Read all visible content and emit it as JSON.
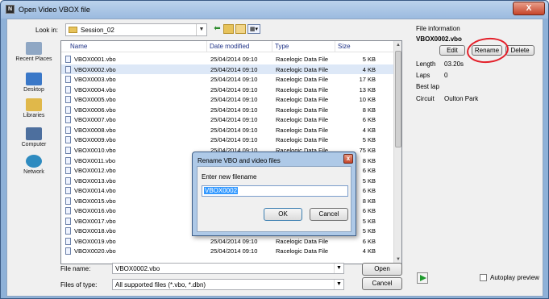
{
  "window": {
    "title": "Open Video VBOX file",
    "app_icon_text": "N",
    "close_glyph": "X"
  },
  "toolbar": {
    "look_in_label": "Look in:",
    "look_in_value": "Session_02"
  },
  "places": [
    {
      "label": "Recent Places",
      "color": "#8fa7c4"
    },
    {
      "label": "Desktop",
      "color": "#3a78c8"
    },
    {
      "label": "Libraries",
      "color": "#e0b84a"
    },
    {
      "label": "Computer",
      "color": "#4d6f9e"
    },
    {
      "label": "Network",
      "color": "#2e8bc0"
    }
  ],
  "file_list": {
    "columns": [
      "Name",
      "Date modified",
      "Type",
      "Size"
    ],
    "rows": [
      {
        "name": "VBOX0001.vbo",
        "date": "25/04/2014 09:10",
        "type": "Racelogic Data File",
        "size": "5 KB",
        "selected": false
      },
      {
        "name": "VBOX0002.vbo",
        "date": "25/04/2014 09:10",
        "type": "Racelogic Data File",
        "size": "4 KB",
        "selected": true
      },
      {
        "name": "VBOX0003.vbo",
        "date": "25/04/2014 09:10",
        "type": "Racelogic Data File",
        "size": "17 KB",
        "selected": false
      },
      {
        "name": "VBOX0004.vbo",
        "date": "25/04/2014 09:10",
        "type": "Racelogic Data File",
        "size": "13 KB",
        "selected": false
      },
      {
        "name": "VBOX0005.vbo",
        "date": "25/04/2014 09:10",
        "type": "Racelogic Data File",
        "size": "10 KB",
        "selected": false
      },
      {
        "name": "VBOX0006.vbo",
        "date": "25/04/2014 09:10",
        "type": "Racelogic Data File",
        "size": "8 KB",
        "selected": false
      },
      {
        "name": "VBOX0007.vbo",
        "date": "25/04/2014 09:10",
        "type": "Racelogic Data File",
        "size": "6 KB",
        "selected": false
      },
      {
        "name": "VBOX0008.vbo",
        "date": "25/04/2014 09:10",
        "type": "Racelogic Data File",
        "size": "4 KB",
        "selected": false
      },
      {
        "name": "VBOX0009.vbo",
        "date": "25/04/2014 09:10",
        "type": "Racelogic Data File",
        "size": "5 KB",
        "selected": false
      },
      {
        "name": "VBOX0010.vbo",
        "date": "25/04/2014 09:10",
        "type": "Racelogic Data File",
        "size": "75 KB",
        "selected": false
      },
      {
        "name": "VBOX0011.vbo",
        "date": "",
        "type": "",
        "size": "8 KB",
        "selected": false
      },
      {
        "name": "VBOX0012.vbo",
        "date": "",
        "type": "",
        "size": "6 KB",
        "selected": false
      },
      {
        "name": "VBOX0013.vbo",
        "date": "",
        "type": "",
        "size": "5 KB",
        "selected": false
      },
      {
        "name": "VBOX0014.vbo",
        "date": "",
        "type": "",
        "size": "6 KB",
        "selected": false
      },
      {
        "name": "VBOX0015.vbo",
        "date": "",
        "type": "",
        "size": "8 KB",
        "selected": false
      },
      {
        "name": "VBOX0016.vbo",
        "date": "",
        "type": "",
        "size": "6 KB",
        "selected": false
      },
      {
        "name": "VBOX0017.vbo",
        "date": "",
        "type": "",
        "size": "5 KB",
        "selected": false
      },
      {
        "name": "VBOX0018.vbo",
        "date": "",
        "type": "",
        "size": "5 KB",
        "selected": false
      },
      {
        "name": "VBOX0019.vbo",
        "date": "25/04/2014 09:10",
        "type": "Racelogic Data File",
        "size": "6 KB",
        "selected": false
      },
      {
        "name": "VBOX0020.vbo",
        "date": "25/04/2014 09:10",
        "type": "Racelogic Data File",
        "size": "4 KB",
        "selected": false
      }
    ]
  },
  "footer": {
    "filename_label": "File name:",
    "filename_value": "VBOX0002.vbo",
    "filetype_label": "Files of type:",
    "filetype_value": "All supported files (*.vbo, *.dbn)",
    "open_label": "Open",
    "cancel_label": "Cancel"
  },
  "info": {
    "title": "File information",
    "filename": "VBOX0002.vbo",
    "edit_label": "Edit",
    "rename_label": "Rename",
    "delete_label": "Delete",
    "length_label": "Length",
    "length_value": "03.20s",
    "laps_label": "Laps",
    "laps_value": "0",
    "bestlap_label": "Best lap",
    "circuit_label": "Circuit",
    "circuit_value": "Oulton Park",
    "autoplay_label": "Autoplay preview"
  },
  "rename_dialog": {
    "title": "Rename VBO and video files",
    "prompt": "Enter new filename",
    "value": "VBOX0002",
    "ok_label": "OK",
    "cancel_label": "Cancel",
    "close_glyph": "x"
  },
  "colors": {
    "annotation": "#e3202a",
    "selection": "#dde8f7",
    "play": "#1f9a2e"
  }
}
